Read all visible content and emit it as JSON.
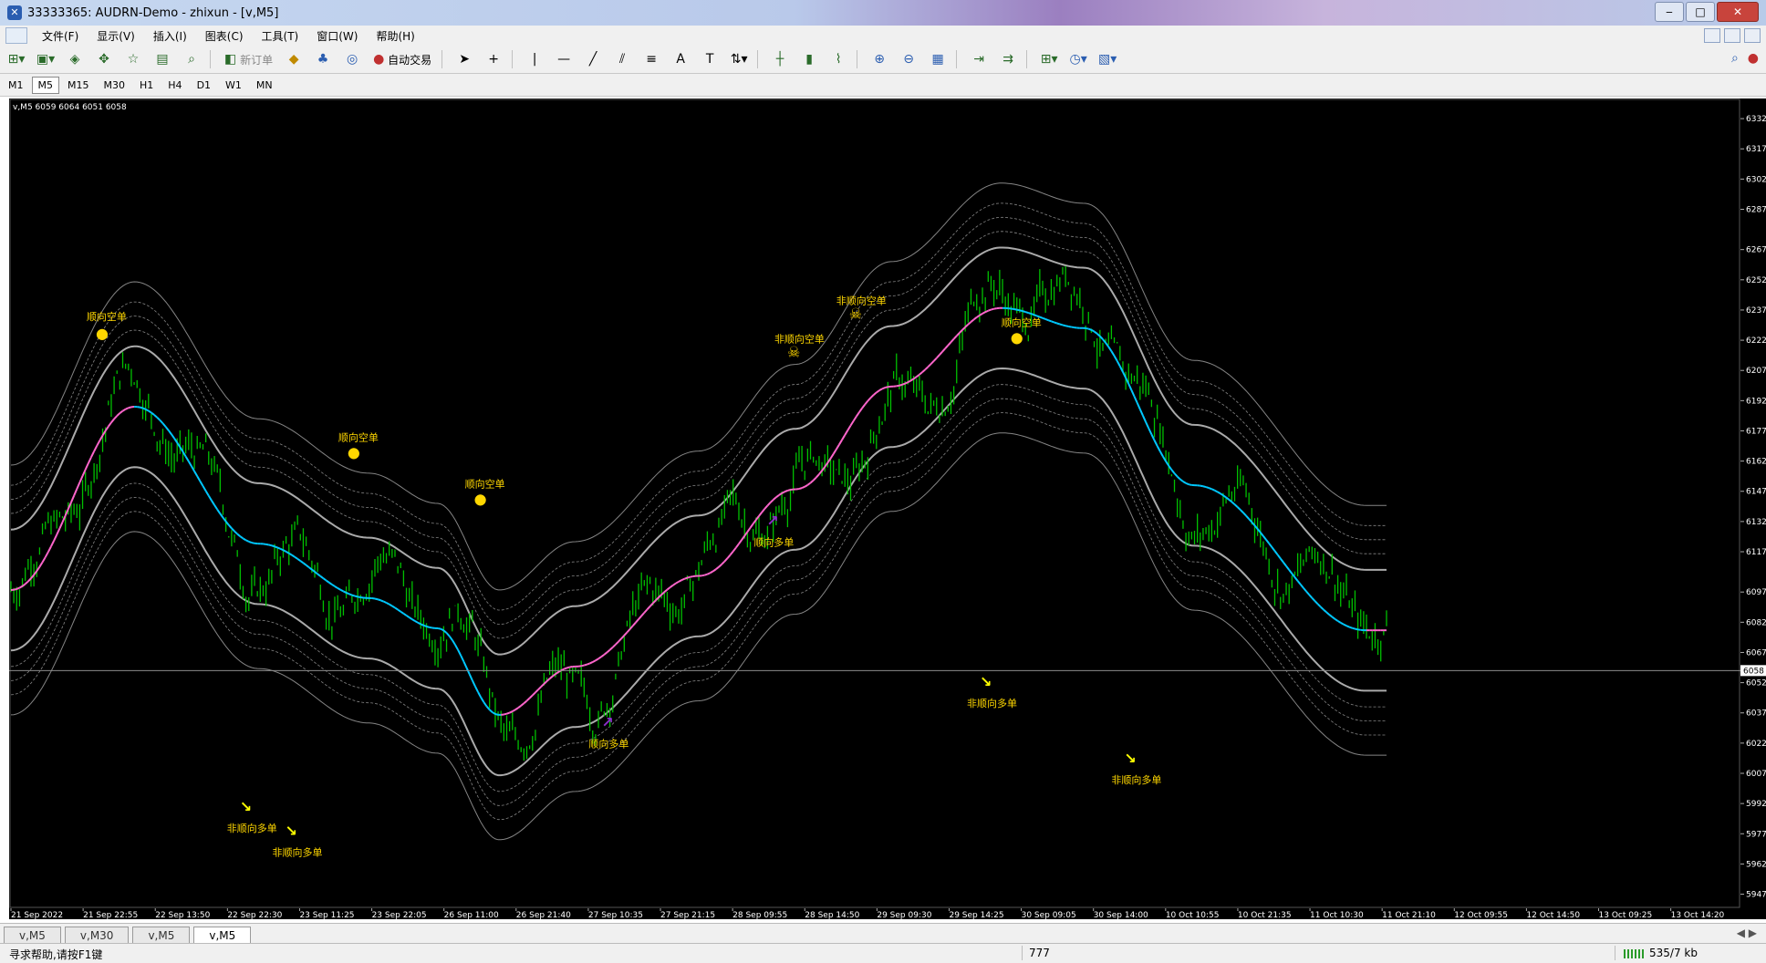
{
  "window": {
    "title": "33333365: AUDRN-Demo - zhixun - [v,M5]"
  },
  "menu": {
    "items": [
      "文件(F)",
      "显示(V)",
      "插入(I)",
      "图表(C)",
      "工具(T)",
      "窗口(W)",
      "帮助(H)"
    ]
  },
  "toolbar": {
    "new_order": "新订单",
    "auto_trading": "自动交易"
  },
  "periods": {
    "items": [
      "M1",
      "M5",
      "M15",
      "M30",
      "H1",
      "H4",
      "D1",
      "W1",
      "MN"
    ],
    "active": "M5"
  },
  "chart": {
    "header": "v,M5  6059 6064 6051 6058",
    "current_price": "6058",
    "price_levels": [
      "6332",
      "6317",
      "6302",
      "6287",
      "6267",
      "6252",
      "6237",
      "6222",
      "6207",
      "6192",
      "6177",
      "6162",
      "6147",
      "6132",
      "6117",
      "6097",
      "6082",
      "6067",
      "6052",
      "6037",
      "6022",
      "6007",
      "5992",
      "5977",
      "5962",
      "5947"
    ],
    "time_labels": [
      "21 Sep 2022",
      "21 Sep 22:55",
      "22 Sep 13:50",
      "22 Sep 22:30",
      "23 Sep 11:25",
      "23 Sep 22:05",
      "26 Sep 11:00",
      "26 Sep 21:40",
      "27 Sep 10:35",
      "27 Sep 21:15",
      "28 Sep 09:55",
      "28 Sep 14:50",
      "29 Sep 09:30",
      "29 Sep 14:25",
      "30 Sep 09:05",
      "30 Sep 14:00",
      "10 Oct 10:55",
      "10 Oct 21:35",
      "11 Oct 10:30",
      "11 Oct 21:10",
      "12 Oct 09:55",
      "12 Oct 14:50",
      "13 Oct 09:25",
      "13 Oct 14:20"
    ],
    "colors": {
      "background": "#000000",
      "candles": "#00c000",
      "ma_up": "#ff66cc",
      "ma_down": "#00c8ff",
      "band": "#bdbdbd",
      "signal_text": "#ffd700",
      "arrow_down": "#ffff00",
      "arrow_up": "#8b2fc9"
    },
    "annotations": [
      {
        "text": "顺向空单",
        "kind": "short"
      },
      {
        "text": "非顺向多单",
        "kind": "long"
      },
      {
        "text": "顺向空单",
        "kind": "short"
      },
      {
        "text": "非顺向多单",
        "kind": "long"
      },
      {
        "text": "顺向空单",
        "kind": "short"
      },
      {
        "text": "顺向多单",
        "kind": "long"
      },
      {
        "text": "非顺向空单",
        "kind": "short"
      },
      {
        "text": "非顺向空单",
        "kind": "short"
      },
      {
        "text": "顺向多单",
        "kind": "long"
      },
      {
        "text": "顺向空单",
        "kind": "short"
      },
      {
        "text": "非顺向多单",
        "kind": "long"
      },
      {
        "text": "非顺向多单",
        "kind": "long"
      }
    ]
  },
  "tabs": {
    "items": [
      "v,M5",
      "v,M30",
      "v,M5",
      "v,M5"
    ],
    "active_index": 3
  },
  "status": {
    "help": "寻求帮助,请按F1键",
    "mid": "777",
    "traffic": "535/7 kb"
  }
}
